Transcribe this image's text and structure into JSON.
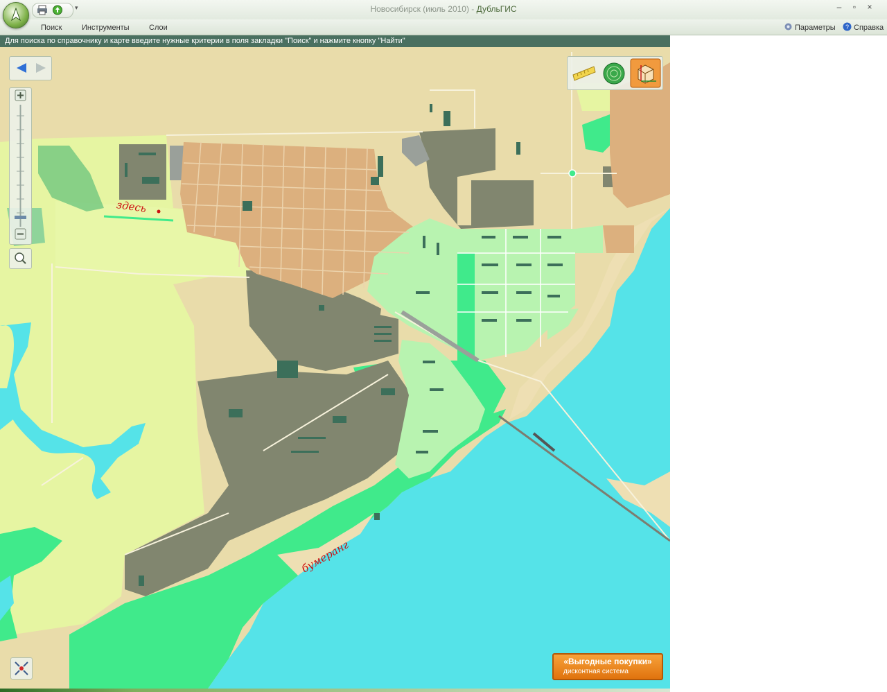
{
  "window": {
    "title": "Новосибирск (июль 2010)",
    "title_separator": " - ",
    "app_name": "ДубльГИС",
    "controls": {
      "minimize": "–",
      "maximize": "▫",
      "close": "×"
    },
    "qat_arrow": "▾"
  },
  "ribbon": {
    "tabs": [
      {
        "label": "Поиск"
      },
      {
        "label": "Инструменты"
      },
      {
        "label": "Слои"
      }
    ],
    "links": [
      {
        "label": "Параметры",
        "icon": "gear-icon"
      },
      {
        "label": "Справка",
        "icon": "help-icon"
      }
    ]
  },
  "hint": "Для поиска по справочнику и карте введите нужные критерии в поля закладки \"Поиск\" и нажмите кнопку \"Найти\"",
  "map": {
    "annotations": [
      {
        "text": "здесь",
        "color": "#cc1111"
      },
      {
        "text": "бумеранг",
        "color": "#cc1111"
      }
    ],
    "colors": {
      "land": "#e9dcaa",
      "sand": "#eedfb3",
      "water": "#55e3e8",
      "forest": "#40ea8b",
      "park": "#e6f5a2",
      "industrial": "#81866f",
      "private_housing": "#dcb07e",
      "residential": "#b8f3b0",
      "building": "#3c6f5a"
    },
    "zoom_level_fraction": 0.2
  },
  "promo": {
    "title": "«Выгодные покупки»",
    "subtitle": "дисконтная система"
  }
}
